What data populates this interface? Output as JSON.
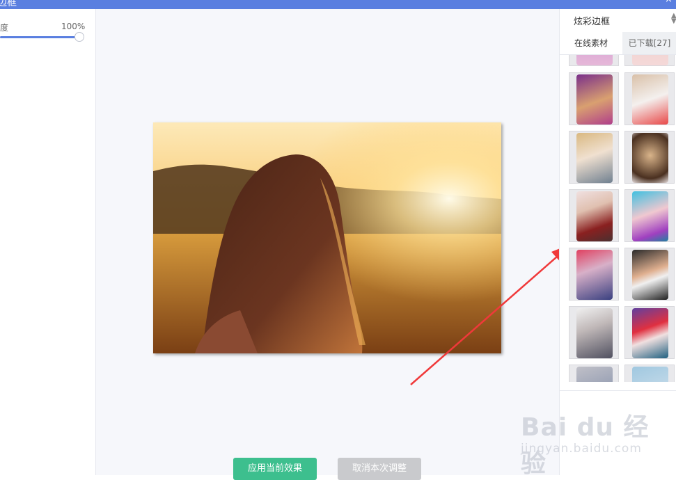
{
  "window": {
    "title": "边框"
  },
  "left_panel": {
    "opacity_label": "度",
    "opacity_value": "100%",
    "opacity_level": 1.0
  },
  "actions": {
    "apply_label": "应用当前效果",
    "cancel_label": "取消本次调整"
  },
  "right_panel": {
    "category": "炫彩边框",
    "tabs": [
      {
        "label": "在线素材",
        "active": true
      },
      {
        "label": "已下载[27]",
        "active": false
      }
    ]
  },
  "watermark": {
    "logo": "Bai du 经验",
    "url": "jingyan.baidu.com"
  },
  "colors": {
    "accent": "#5a7fe0",
    "apply": "#3dbf8e",
    "cancel": "#c9cacd",
    "arrow": "#f0393a"
  }
}
